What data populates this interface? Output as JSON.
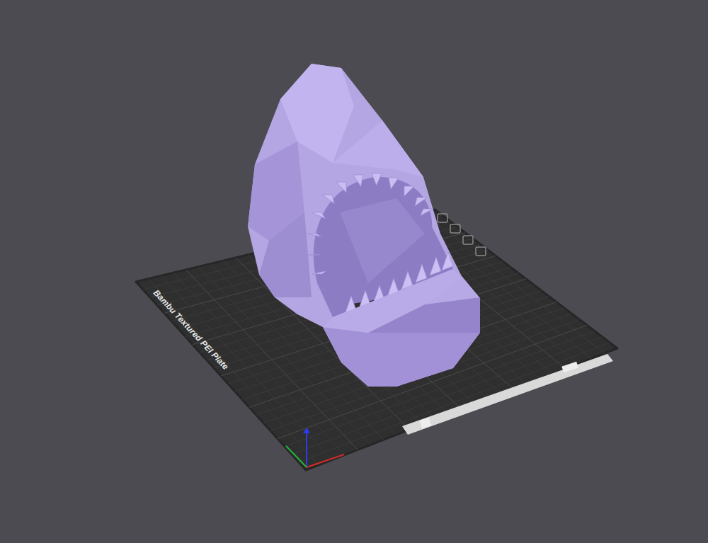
{
  "viewport": {
    "plate": {
      "label": "Bambu Textured PEI Plate"
    }
  }
}
